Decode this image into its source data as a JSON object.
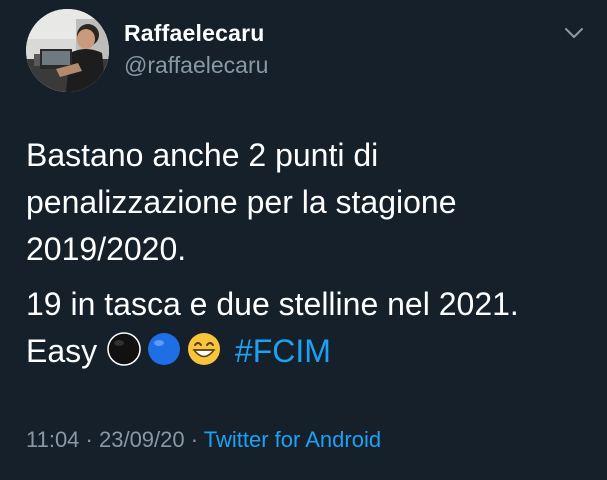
{
  "author": {
    "display_name": "Raffaelecaru",
    "handle": "@raffaelecaru",
    "avatar_icon": "user-avatar-photo"
  },
  "menu_icon": "chevron-down-icon",
  "tweet": {
    "paragraph1": "Bastano anche 2 punti di penalizzazione per la stagione 2019/2020.",
    "paragraph2_text": "19 in tasca e due stelline nel 2021.",
    "paragraph2_prefix": "Easy",
    "emojis": [
      "black-circle-emoji",
      "blue-circle-emoji",
      "grinning-squinting-face-emoji"
    ],
    "hashtag": "#FCIM"
  },
  "meta": {
    "time": "11:04",
    "separator1": " · ",
    "date": "23/09/20",
    "separator2": " · ",
    "source": "Twitter for Android"
  },
  "colors": {
    "background": "#15202b",
    "text": "#ffffff",
    "secondary": "#8899a6",
    "link": "#1da1f2"
  }
}
